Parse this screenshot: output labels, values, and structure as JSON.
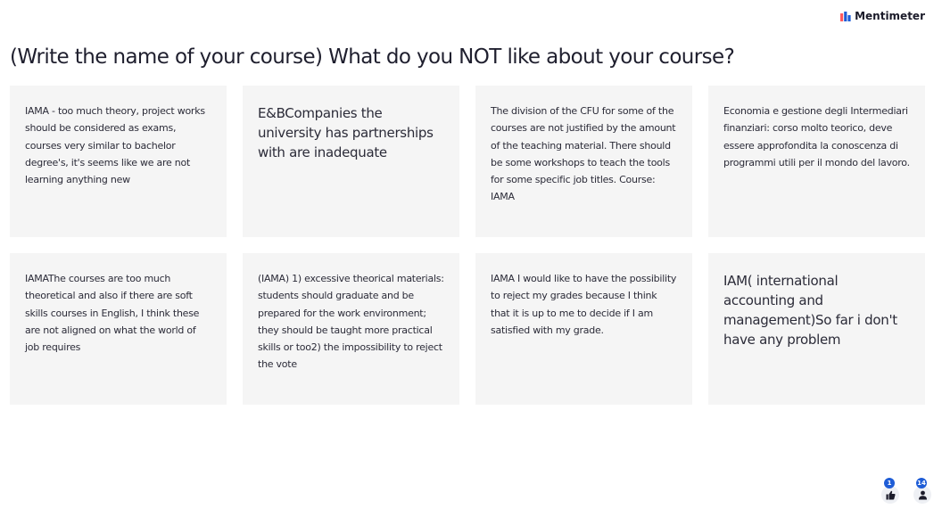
{
  "brand": {
    "name": "Mentimeter",
    "icon": "mentimeter-logo-icon",
    "colors": [
      "#ff5a5f",
      "#1f5dd6"
    ]
  },
  "question": {
    "title": "(Write the name of your course) What do you NOT like about your course?"
  },
  "responses": [
    {
      "text": "IAMA - too much theory, project works should be considered as exams, courses very similar to bachelor degree's, it's seems like we are not learning anything new",
      "size": "small"
    },
    {
      "text": "E&BCompanies the university has partnerships with are inadequate",
      "size": "large"
    },
    {
      "text": "The division of the CFU for some of the courses are not justified by the amount of the teaching material. There should be some workshops to teach the tools for some specific job titles. Course: IAMA",
      "size": "small"
    },
    {
      "text": "Economia e gestione degli Intermediari finanziari: corso molto teorico, deve essere approfondita la conoscenza di programmi utili per il mondo del lavoro.",
      "size": "small"
    },
    {
      "text": "IAMAThe courses are too much theoretical and also if there are soft skills courses in English, I think these are not aligned on what the world of job requires",
      "size": "small"
    },
    {
      "text": "(IAMA) 1) excessive theorical materials: students should graduate and be prepared for the work environment; they should be taught more practical skills or too2) the impossibility to reject the vote",
      "size": "small"
    },
    {
      "text": "IAMA I would like to have the possibility to reject my grades because I think that it is up to me to decide if I am satisfied with my grade.",
      "size": "small"
    },
    {
      "text": "IAM( international accounting and management)So far i don't have any problem",
      "size": "large"
    }
  ],
  "controls": {
    "reactions": {
      "count": "1",
      "icon": "thumbs-up-icon"
    },
    "participants": {
      "count": "14",
      "icon": "person-icon"
    }
  },
  "colors": {
    "card_background": "#f5f5f5",
    "badge": "#1f5dd6",
    "text": "#1f1f2e"
  }
}
